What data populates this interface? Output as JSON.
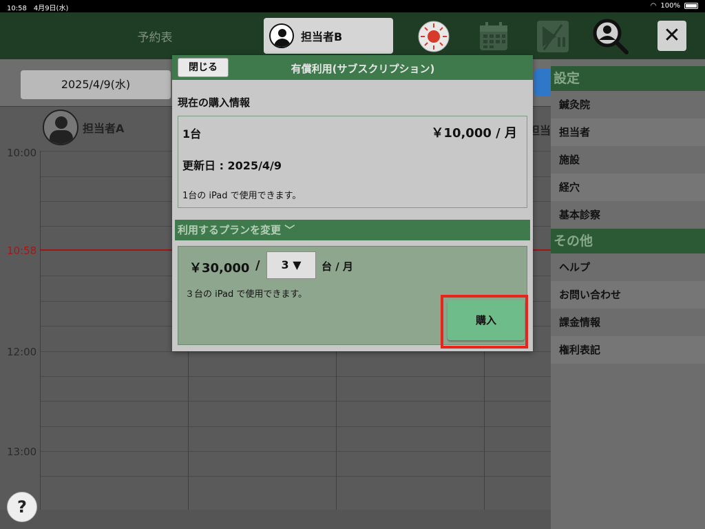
{
  "statusbar": {
    "time": "10:58",
    "date": "4月9日(水)",
    "battery": "100%"
  },
  "header": {
    "title": "予約表",
    "staff_button_label": "担当者B",
    "icons": [
      "sun-icon",
      "calendar-icon",
      "play-pause-icon",
      "search-user-icon"
    ],
    "close_label": "✕"
  },
  "schedule": {
    "date_label": "2025/4/9(水)",
    "staff_a": "担当者A",
    "staff_peek": "担当",
    "times": [
      "10:00",
      "10:58",
      "12:00",
      "13:00"
    ],
    "help_label": "?"
  },
  "settings_panel": {
    "section1": "設定",
    "items1": [
      "鍼灸院",
      "担当者",
      "施設",
      "経穴",
      "基本診察"
    ],
    "section2": "その他",
    "items2": [
      "ヘルプ",
      "お問い合わせ",
      "課金情報",
      "権利表記"
    ]
  },
  "modal": {
    "close_label": "閉じる",
    "title": "有償利用(サブスクリプション)",
    "current_heading": "現在の購入情報",
    "current_units": "1台",
    "current_price": "￥10,000 / 月",
    "current_renew": "更新日 : 2025/4/9",
    "current_note": "1台の iPad で使用できます。",
    "plan_bar_label": "利用するプランを変更 ﹀",
    "plan_price": "￥30,000",
    "plan_slash": "/",
    "plan_select_value": "3 ▼",
    "plan_unit": "台 / 月",
    "plan_note": "３台の iPad で使用できます。",
    "buy_label": "購入"
  },
  "colors": {
    "accent_green": "#3f7a4c",
    "buy_button": "#6fbc8b",
    "highlight": "#e8251b",
    "now_line": "#9d1616"
  }
}
